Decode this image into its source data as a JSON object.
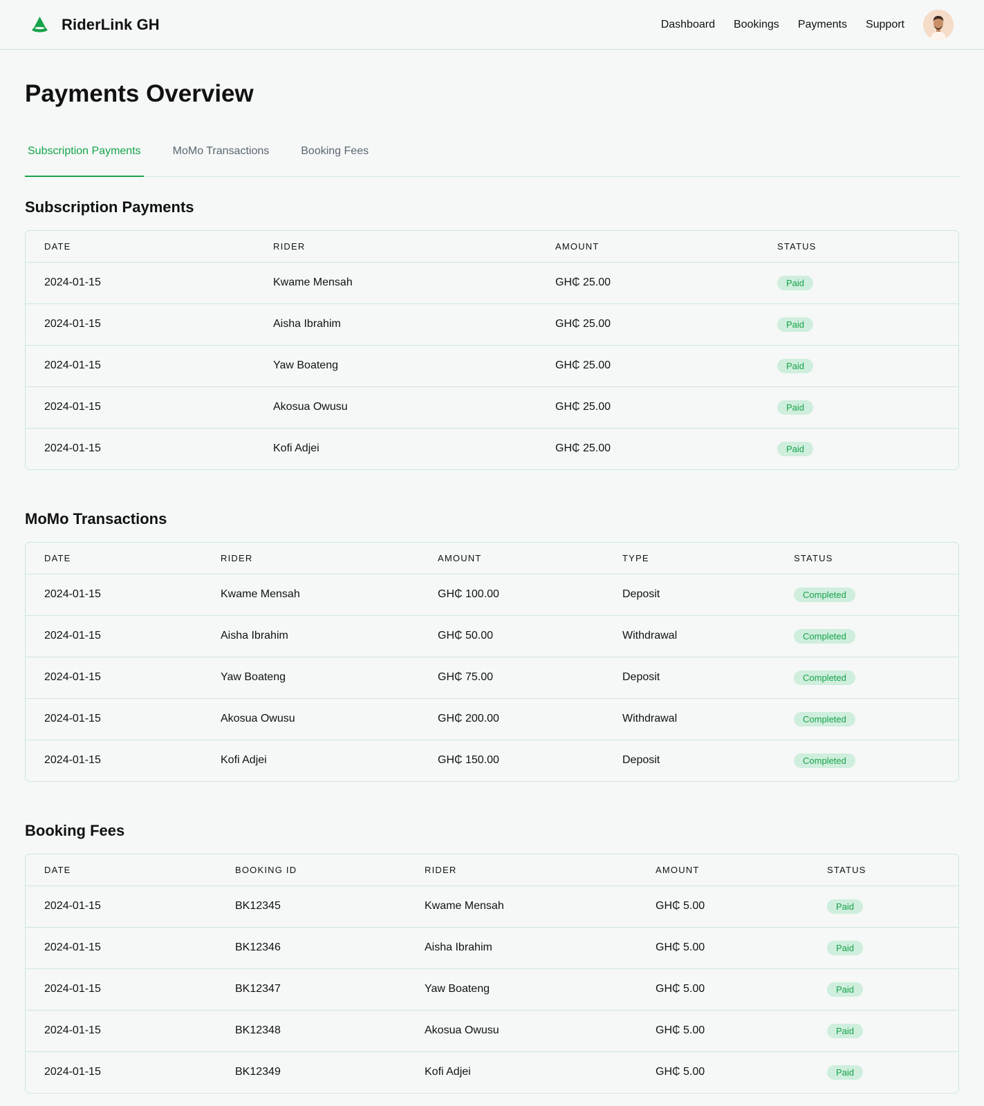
{
  "header": {
    "brand": "RiderLink GH",
    "nav": [
      "Dashboard",
      "Bookings",
      "Payments",
      "Support"
    ]
  },
  "page": {
    "title": "Payments Overview",
    "tabs": [
      "Subscription Payments",
      "MoMo Transactions",
      "Booking Fees"
    ],
    "active_tab": "Subscription Payments"
  },
  "subscription": {
    "title": "Subscription Payments",
    "headers": [
      "DATE",
      "RIDER",
      "AMOUNT",
      "STATUS"
    ],
    "rows": [
      [
        "2024-01-15",
        "Kwame Mensah",
        "GH₵ 25.00",
        "Paid"
      ],
      [
        "2024-01-15",
        "Aisha Ibrahim",
        "GH₵ 25.00",
        "Paid"
      ],
      [
        "2024-01-15",
        "Yaw Boateng",
        "GH₵ 25.00",
        "Paid"
      ],
      [
        "2024-01-15",
        "Akosua Owusu",
        "GH₵ 25.00",
        "Paid"
      ],
      [
        "2024-01-15",
        "Kofi Adjei",
        "GH₵ 25.00",
        "Paid"
      ]
    ]
  },
  "momo": {
    "title": "MoMo Transactions",
    "headers": [
      "DATE",
      "RIDER",
      "AMOUNT",
      "TYPE",
      "STATUS"
    ],
    "rows": [
      [
        "2024-01-15",
        "Kwame Mensah",
        "GH₵ 100.00",
        "Deposit",
        "Completed"
      ],
      [
        "2024-01-15",
        "Aisha Ibrahim",
        "GH₵ 50.00",
        "Withdrawal",
        "Completed"
      ],
      [
        "2024-01-15",
        "Yaw Boateng",
        "GH₵ 75.00",
        "Deposit",
        "Completed"
      ],
      [
        "2024-01-15",
        "Akosua Owusu",
        "GH₵ 200.00",
        "Withdrawal",
        "Completed"
      ],
      [
        "2024-01-15",
        "Kofi Adjei",
        "GH₵ 150.00",
        "Deposit",
        "Completed"
      ]
    ]
  },
  "booking": {
    "title": "Booking Fees",
    "headers": [
      "DATE",
      "BOOKING ID",
      "RIDER",
      "AMOUNT",
      "STATUS"
    ],
    "rows": [
      [
        "2024-01-15",
        "BK12345",
        "Kwame Mensah",
        "GH₵ 5.00",
        "Paid"
      ],
      [
        "2024-01-15",
        "BK12346",
        "Aisha Ibrahim",
        "GH₵ 5.00",
        "Paid"
      ],
      [
        "2024-01-15",
        "BK12347",
        "Yaw Boateng",
        "GH₵ 5.00",
        "Paid"
      ],
      [
        "2024-01-15",
        "BK12348",
        "Akosua Owusu",
        "GH₵ 5.00",
        "Paid"
      ],
      [
        "2024-01-15",
        "BK12349",
        "Kofi Adjei",
        "GH₵ 5.00",
        "Paid"
      ]
    ]
  },
  "colors": {
    "accent": "#16a34a",
    "badge_bg": "#cfeedd",
    "border": "#cfe6dd",
    "background": "#f5f8f7"
  },
  "icons": {
    "logo": "rider-cone-icon",
    "avatar": "user-avatar"
  }
}
